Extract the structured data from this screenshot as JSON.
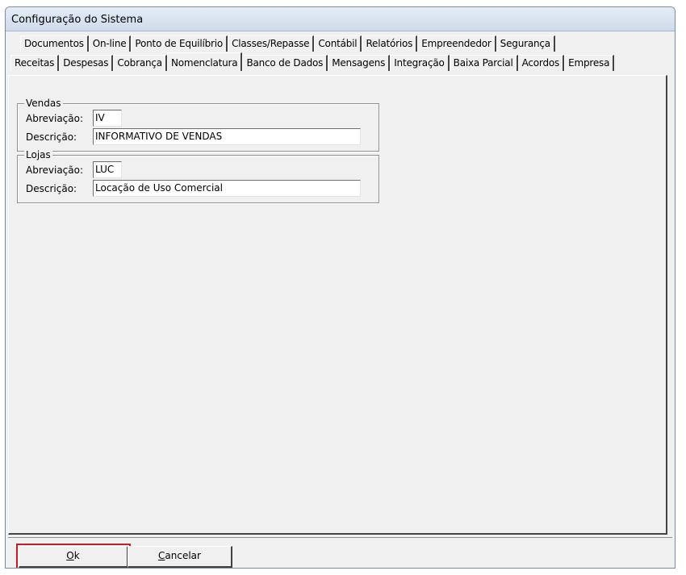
{
  "window": {
    "title": "Configuração do Sistema"
  },
  "tabs": {
    "row1": [
      "Documentos",
      "On-line",
      "Ponto de Equilíbrio",
      "Classes/Repasse",
      "Contábil",
      "Relatórios",
      "Empreendedor",
      "Segurança"
    ],
    "row2": [
      "Receitas",
      "Despesas",
      "Cobrança",
      "Nomenclatura",
      "Banco de Dados",
      "Mensagens",
      "Integração",
      "Baixa Parcial",
      "Acordos",
      "Empresa"
    ],
    "active": "Nomenclatura"
  },
  "vendas": {
    "legend": "Vendas",
    "abrev_label": "Abreviação:",
    "abrev_value": "IV",
    "desc_label": "Descrição:",
    "desc_value": "INFORMATIVO DE VENDAS"
  },
  "lojas": {
    "legend": "Lojas",
    "abrev_label": "Abreviação:",
    "abrev_value": "LUC",
    "desc_label": "Descrição:",
    "desc_value": "Locação de Uso Comercial"
  },
  "buttons": {
    "ok_first": "O",
    "ok_rest": "k",
    "cancel_first": "C",
    "cancel_rest": "ancelar"
  }
}
